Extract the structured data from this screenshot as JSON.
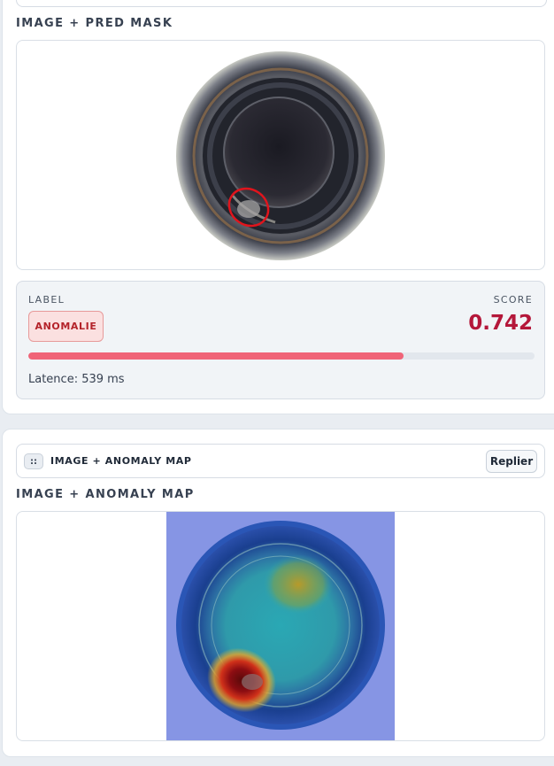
{
  "panel1": {
    "section_title": "IMAGE + PRED MASK"
  },
  "result": {
    "label_caption": "LABEL",
    "label_value": "ANOMALIE",
    "score_caption": "SCORE",
    "score_value": "0.742",
    "score_fraction": 0.742,
    "latency": "Latence: 539 ms"
  },
  "panel2": {
    "accordion_title": "IMAGE + ANOMALY MAP",
    "handle_glyph": "::",
    "collapse_label": "Replier",
    "section_title": "IMAGE + ANOMALY MAP"
  },
  "colors": {
    "anomaly_badge_bg": "#fbe0e0",
    "anomaly_text": "#b4232a",
    "score_text": "#b4173a",
    "bar_fill": "#f06478",
    "mask_outline": "#e0141c"
  },
  "icons": {
    "drag_handle": "drag-handle-icon"
  }
}
